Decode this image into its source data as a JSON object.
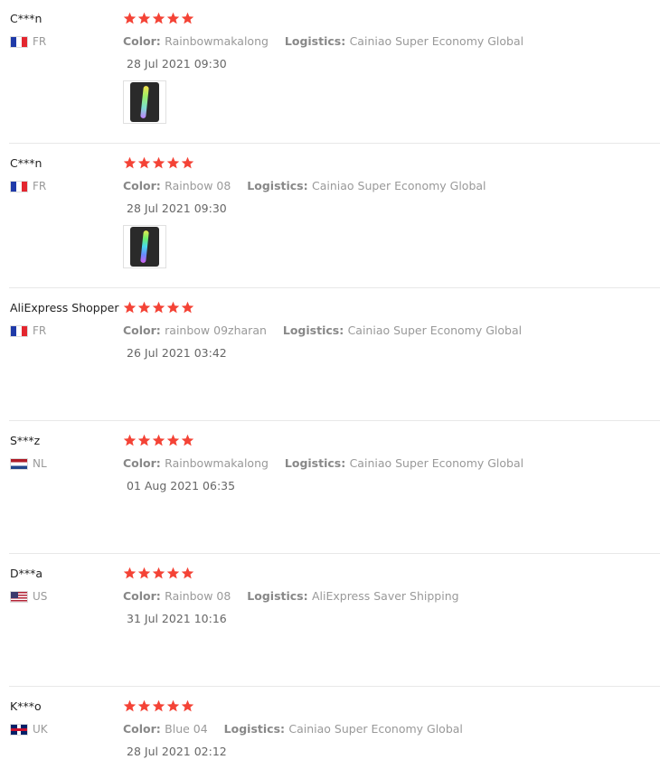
{
  "labels": {
    "color": "Color:",
    "logistics": "Logistics:"
  },
  "colors": {
    "star": "#f44336",
    "meta_label": "#888888",
    "meta_value": "#999999"
  },
  "reviews": [
    {
      "user": "C***n",
      "country": "FR",
      "flag": "flag-fr",
      "rating": 5,
      "color": "Rainbowmakalong",
      "logistics": "Cainiao Super Economy Global",
      "date": "28 Jul 2021 09:30",
      "has_photo": true,
      "photo_icon": "light-stick-photo"
    },
    {
      "user": "C***n",
      "country": "FR",
      "flag": "flag-fr",
      "rating": 5,
      "color": "Rainbow 08",
      "logistics": "Cainiao Super Economy Global",
      "date": "28 Jul 2021 09:30",
      "has_photo": true,
      "photo_icon": "light-stick-photo"
    },
    {
      "user": "AliExpress Shopper",
      "country": "FR",
      "flag": "flag-fr",
      "rating": 5,
      "color": "rainbow 09zharan",
      "logistics": "Cainiao Super Economy Global",
      "date": "26 Jul 2021 03:42",
      "has_photo": false
    },
    {
      "user": "S***z",
      "country": "NL",
      "flag": "flag-nl",
      "rating": 5,
      "color": "Rainbowmakalong",
      "logistics": "Cainiao Super Economy Global",
      "date": "01 Aug 2021 06:35",
      "has_photo": false
    },
    {
      "user": "D***a",
      "country": "US",
      "flag": "flag-us",
      "rating": 5,
      "color": "Rainbow 08",
      "logistics": "AliExpress Saver Shipping",
      "date": "31 Jul 2021 10:16",
      "has_photo": false
    },
    {
      "user": "K***o",
      "country": "UK",
      "flag": "flag-uk",
      "rating": 5,
      "color": "Blue 04",
      "logistics": "Cainiao Super Economy Global",
      "date": "28 Jul 2021 02:12",
      "has_photo": false
    }
  ]
}
